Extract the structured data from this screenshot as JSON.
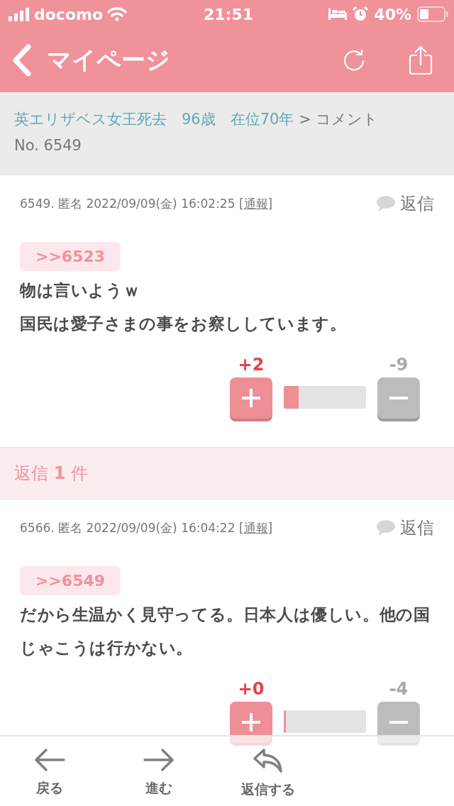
{
  "status_bar": {
    "carrier": "docomo",
    "time": "21:51",
    "battery": "40%"
  },
  "nav": {
    "title": "マイページ"
  },
  "breadcrumb": {
    "link": "英エリザベス女王死去　96歳　在位70年",
    "rest": " > コメント No. 6549"
  },
  "comment": {
    "meta_prefix": "6549. 匿名 2022/09/09(金) 16:02:25 [",
    "report": "通報",
    "meta_suffix": "]",
    "reply": "返信",
    "anchor": ">>6523",
    "body": [
      "物は言いようｗ",
      "国民は愛子さまの事をお察ししています。"
    ],
    "plus": "+2",
    "minus": "-9",
    "level": 0.18
  },
  "replies_header": "返信 **1** 件",
  "replies": [
    {
      "meta_prefix": "6566. 匿名 2022/09/09(金) 16:04:22 [",
      "report": "通報",
      "meta_suffix": "]",
      "reply": "返信",
      "anchor": ">>6549",
      "body": [
        "だから生温かく見守ってる。日本人は優しい。他の国じゃこうは行かない。"
      ],
      "plus": "+0",
      "minus": "-4",
      "level": 0.03
    }
  ],
  "toolbar": [
    {
      "kind": "back",
      "label": "戻る"
    },
    {
      "kind": "forward",
      "label": "進む"
    },
    {
      "kind": "reply",
      "label": "返信する"
    }
  ]
}
